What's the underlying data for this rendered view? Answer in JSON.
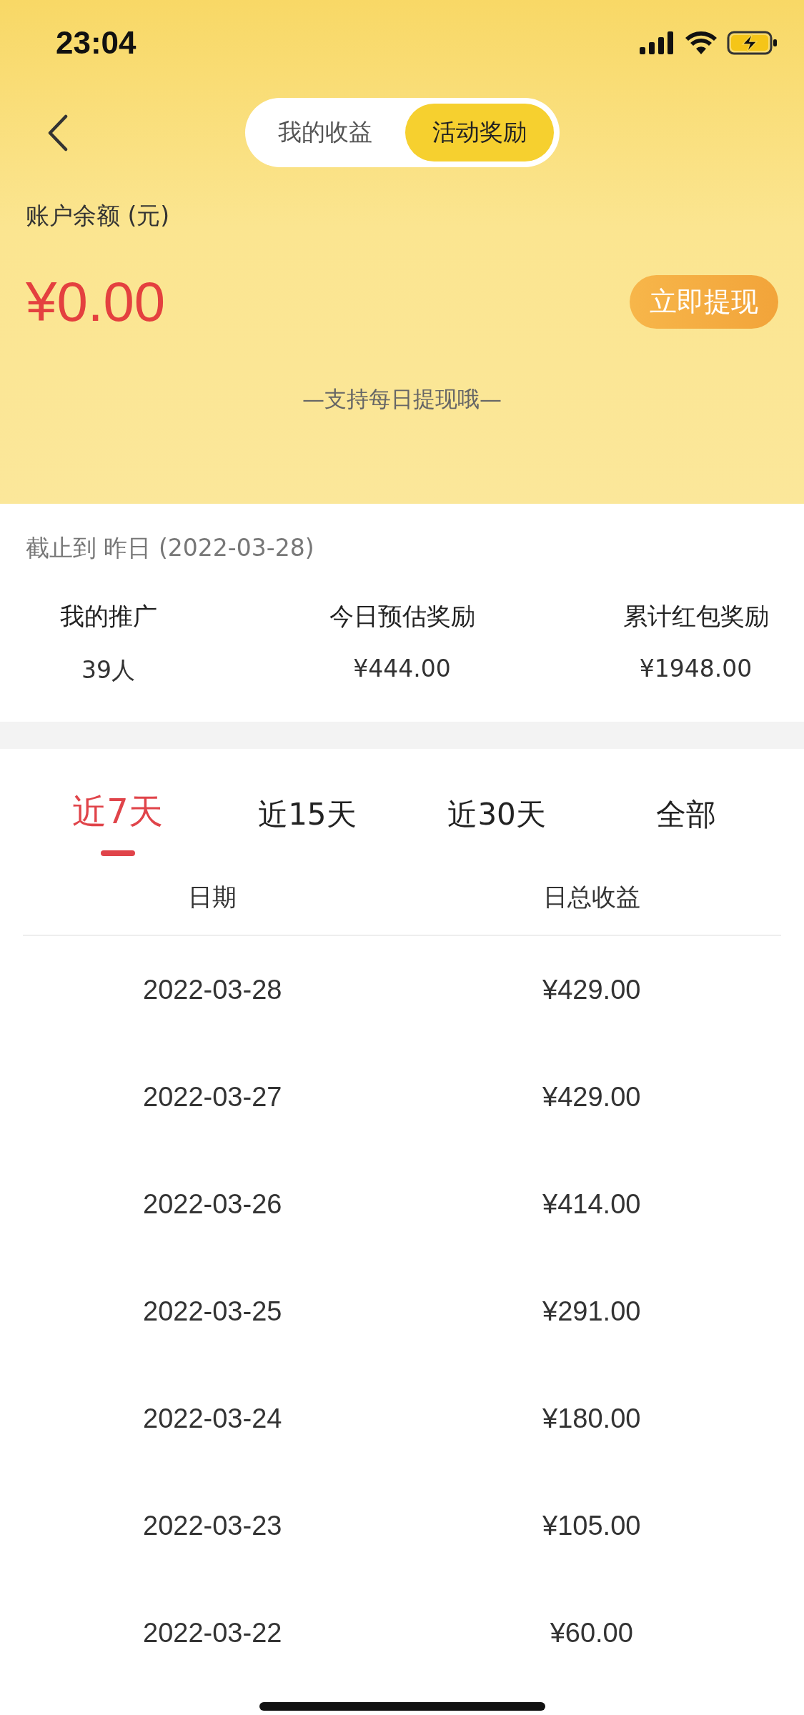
{
  "status_bar": {
    "time": "23:04"
  },
  "header": {
    "segments": [
      {
        "label": "我的收益",
        "selected": false
      },
      {
        "label": "活动奖励",
        "selected": true
      }
    ],
    "balance_label": "账户余额 (元)",
    "balance": "¥0.00",
    "withdraw_button": "立即提现",
    "note": "—支持每日提现哦—"
  },
  "summary": {
    "as_of": "截止到 昨日 (2022-03-28)",
    "stats": [
      {
        "label": "我的推广",
        "value": "39人"
      },
      {
        "label": "今日预估奖励",
        "value": "¥444.00"
      },
      {
        "label": "累计红包奖励",
        "value": "¥1948.00"
      }
    ]
  },
  "period_tabs": [
    {
      "label": "近7天",
      "selected": true
    },
    {
      "label": "近15天",
      "selected": false
    },
    {
      "label": "近30天",
      "selected": false
    },
    {
      "label": "全部",
      "selected": false
    }
  ],
  "table": {
    "columns": [
      "日期",
      "日总收益"
    ],
    "rows": [
      [
        "2022-03-28",
        "¥429.00"
      ],
      [
        "2022-03-27",
        "¥429.00"
      ],
      [
        "2022-03-26",
        "¥414.00"
      ],
      [
        "2022-03-25",
        "¥291.00"
      ],
      [
        "2022-03-24",
        "¥180.00"
      ],
      [
        "2022-03-23",
        "¥105.00"
      ],
      [
        "2022-03-22",
        "¥60.00"
      ]
    ]
  }
}
